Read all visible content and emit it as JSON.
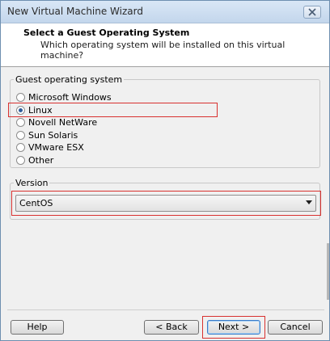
{
  "window": {
    "title": "New Virtual Machine Wizard",
    "close_icon": "close-icon"
  },
  "header": {
    "title": "Select a Guest Operating System",
    "subtitle": "Which operating system will be installed on this virtual machine?"
  },
  "guest_os": {
    "group_label": "Guest operating system",
    "options": [
      {
        "label": "Microsoft Windows",
        "checked": false
      },
      {
        "label": "Linux",
        "checked": true
      },
      {
        "label": "Novell NetWare",
        "checked": false
      },
      {
        "label": "Sun Solaris",
        "checked": false
      },
      {
        "label": "VMware ESX",
        "checked": false
      },
      {
        "label": "Other",
        "checked": false
      }
    ]
  },
  "version": {
    "group_label": "Version",
    "selected": "CentOS"
  },
  "buttons": {
    "help": "Help",
    "back": "< Back",
    "next": "Next >",
    "cancel": "Cancel"
  },
  "colors": {
    "highlight": "#d8312f",
    "radio_dot": "#2e5d9b"
  }
}
